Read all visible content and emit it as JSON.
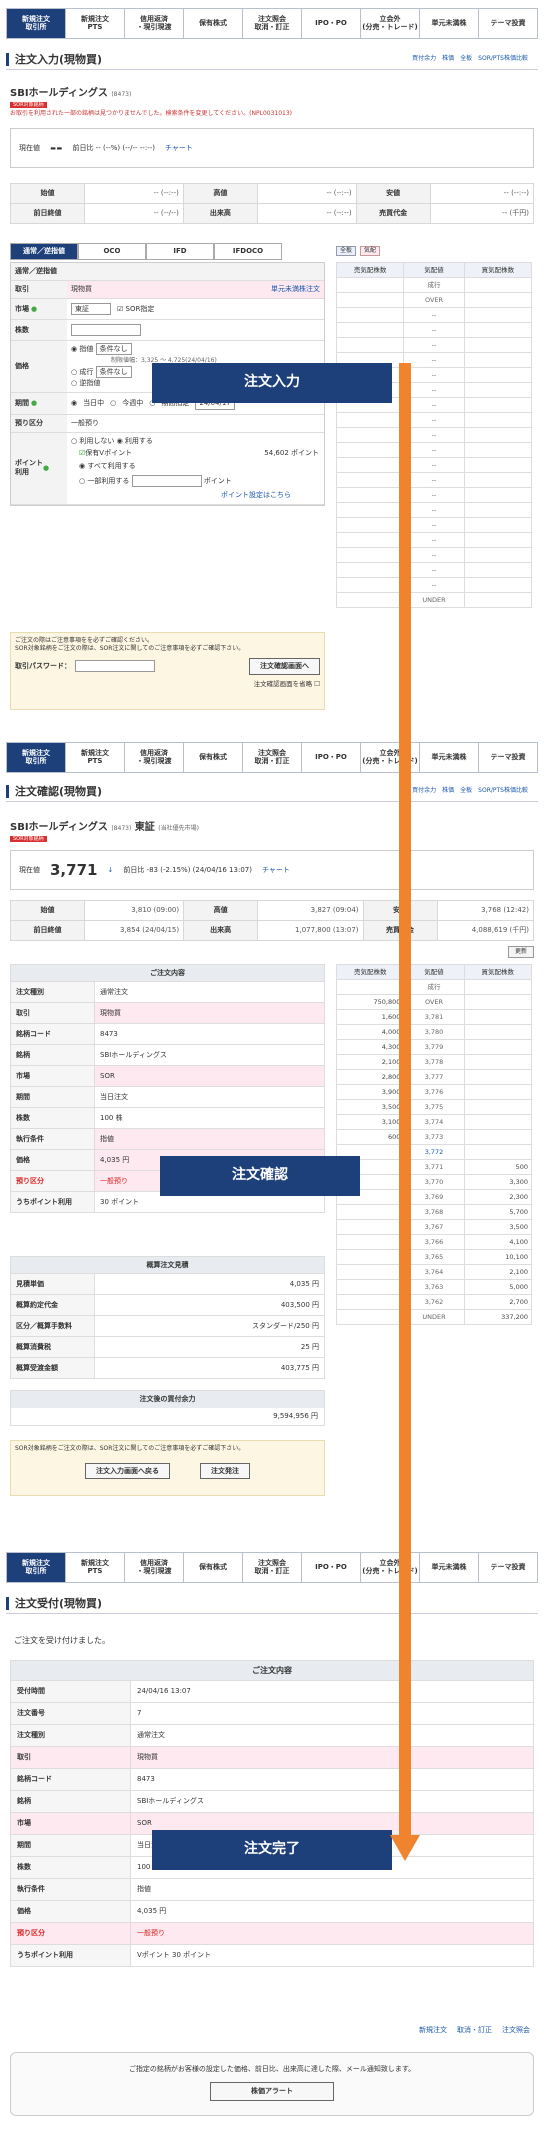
{
  "nav": [
    "新規注文\n取引所",
    "新規注文\nPTS",
    "信用返済\n・現引現渡",
    "保有株式",
    "注文照会\n取消・訂正",
    "IPO・PO",
    "立会外\n(分売・トレード)",
    "単元未満株",
    "テーマ投資"
  ],
  "s1": {
    "title": "注文入力(現物買)",
    "links": [
      "買付余力",
      "株価",
      "全板",
      "SOR/PTS株価比較"
    ],
    "stock": "SBIホールディングス",
    "code": "(8473)",
    "badge": "SOR対象銘柄",
    "note": "お取引を利用された一部の銘柄は見つかりませんでした。検索条件を変更してください。(NPL0031013)",
    "price_label": "現在値",
    "price": "--",
    "change": "前日比 -- (--%) (--/-- --:--)",
    "chart": "チャート",
    "quote": [
      [
        "始値",
        "-- (--:--)",
        "高値",
        "-- (--:--)",
        "安値",
        "-- (--:--)"
      ],
      [
        "前日終値",
        "-- (--/--)",
        "出来高",
        "-- (--:--)",
        "売買代金",
        "-- (千円)"
      ]
    ],
    "tabs": [
      "通常／逆指値",
      "OCO",
      "IFD",
      "IFDOCO"
    ],
    "form_head": "通常／逆指値",
    "trade": "現物買",
    "unit_link": "単元未満株注文",
    "market": "東証",
    "sor": "SOR指定",
    "price_opts": [
      "指値",
      "条件なし",
      "成行",
      "逆指値"
    ],
    "price_range": "制限値幅：3,325 ～ 4,725(24/04/16)",
    "period": [
      "当日中",
      "今週中",
      "期間指定",
      "24/04/17"
    ],
    "deposit": "一般預り",
    "point_opts": [
      "利用しない",
      "利用する"
    ],
    "vpoint": "保有Vポイント",
    "vpoint_val": "54,602 ポイント",
    "point_all": "すべて利用する",
    "point_part": "一部利用する",
    "point_unit": "ポイント",
    "point_link": "ポイント設定はこちら",
    "caution1": "ご注文の際はご注意事項をを必ずご確認ください。",
    "caution2": "SOR対象銘柄をご注文の際は、SOR注文に関してのご注意事項を必ずご確認下さい。",
    "pw_label": "取引パスワード：",
    "confirm_btn": "注文確認画面へ",
    "skip": "注文確認画面を省略",
    "book_btns": [
      "全板",
      "気配"
    ],
    "book_head": [
      "売気配株数",
      "気配値",
      "買気配株数"
    ],
    "book_rows": [
      [
        "",
        "成行",
        ""
      ],
      [
        "",
        "OVER",
        ""
      ],
      [
        "",
        "--",
        ""
      ],
      [
        "",
        "--",
        ""
      ],
      [
        "",
        "--",
        ""
      ],
      [
        "",
        "--",
        ""
      ],
      [
        "",
        "--",
        ""
      ],
      [
        "",
        "--",
        ""
      ],
      [
        "",
        "--",
        ""
      ],
      [
        "",
        "--",
        ""
      ],
      [
        "",
        "--",
        ""
      ],
      [
        "",
        "--",
        ""
      ],
      [
        "",
        "--",
        ""
      ],
      [
        "",
        "--",
        ""
      ],
      [
        "",
        "--",
        ""
      ],
      [
        "",
        "--",
        ""
      ],
      [
        "",
        "--",
        ""
      ],
      [
        "",
        "--",
        ""
      ],
      [
        "",
        "--",
        ""
      ],
      [
        "",
        "--",
        ""
      ],
      [
        "",
        "--",
        ""
      ],
      [
        "",
        "UNDER",
        ""
      ]
    ],
    "label": "注文入力"
  },
  "s2": {
    "title": "注文確認(現物買)",
    "stock": "SBIホールディングス",
    "code": "(8473)",
    "market": "東証",
    "sub": "(当社優先市場)",
    "badge": "SOR対象銘柄",
    "price_label": "現在値",
    "price": "3,771",
    "change": "前日比 -83 (-2.15%) (24/04/16 13:07)",
    "chart": "チャート",
    "quote": [
      [
        "始値",
        "3,810 (09:00)",
        "高値",
        "3,827 (09:04)",
        "安値",
        "3,768 (12:42)"
      ],
      [
        "前日終値",
        "3,854 (24/04/15)",
        "出来高",
        "1,077,800 (13:07)",
        "売買代金",
        "4,088,619 (千円)"
      ]
    ],
    "update": "更新",
    "conf_head": "ご注文内容",
    "conf": [
      [
        "注文種別",
        "通常注文",
        false
      ],
      [
        "取引",
        "現物買",
        true
      ],
      [
        "銘柄コード",
        "8473",
        false
      ],
      [
        "銘柄",
        "SBIホールディングス",
        false
      ],
      [
        "市場",
        "SOR",
        true
      ],
      [
        "期間",
        "当日注文",
        false
      ],
      [
        "株数",
        "100 株",
        false
      ],
      [
        "執行条件",
        "指値",
        true
      ],
      [
        "価格",
        "4,035 円",
        true
      ],
      [
        "預り区分",
        "一般預り",
        true
      ],
      [
        "うちポイント利用",
        "30 ポイント",
        false
      ]
    ],
    "est_head": "概算注文見積",
    "est": [
      [
        "見積単価",
        "4,035 円"
      ],
      [
        "概算約定代金",
        "403,500 円"
      ],
      [
        "区分／概算手数料",
        "スタンダード/250 円"
      ],
      [
        "概算消費税",
        "25 円"
      ],
      [
        "概算受渡金額",
        "403,775 円"
      ]
    ],
    "after_head": "注文後の買付余力",
    "after": "9,594,956 円",
    "caution": "SOR対象銘柄をご注文の際は、SOR注文に関してのご注意事項を必ずご確認下さい。",
    "back_btn": "注文入力画面へ戻る",
    "order_btn": "注文発注",
    "book_head": [
      "売気配株数",
      "気配値",
      "買気配株数"
    ],
    "book_rows": [
      [
        "",
        "成行",
        ""
      ],
      [
        "750,800",
        "OVER",
        ""
      ],
      [
        "1,600",
        "3,781",
        ""
      ],
      [
        "4,000",
        "3,780",
        ""
      ],
      [
        "4,300",
        "3,779",
        ""
      ],
      [
        "2,100",
        "3,778",
        ""
      ],
      [
        "2,800",
        "3,777",
        ""
      ],
      [
        "3,900",
        "3,776",
        ""
      ],
      [
        "3,500",
        "3,775",
        ""
      ],
      [
        "3,100",
        "3,774",
        ""
      ],
      [
        "600",
        "3,773",
        ""
      ],
      [
        "",
        "3,772",
        ""
      ],
      [
        "",
        "3,771",
        "500"
      ],
      [
        "",
        "3,770",
        "3,300"
      ],
      [
        "",
        "3,769",
        "2,300"
      ],
      [
        "",
        "3,768",
        "5,700"
      ],
      [
        "",
        "3,767",
        "3,500"
      ],
      [
        "",
        "3,766",
        "4,100"
      ],
      [
        "",
        "3,765",
        "10,100"
      ],
      [
        "",
        "3,764",
        "2,100"
      ],
      [
        "",
        "3,763",
        "5,000"
      ],
      [
        "",
        "3,762",
        "2,700"
      ],
      [
        "",
        "UNDER",
        "337,200"
      ]
    ],
    "label": "注文確認"
  },
  "s3": {
    "title": "注文受付(現物買)",
    "msg": "ご注文を受け付けました。",
    "head": "ご注文内容",
    "rows": [
      [
        "受付時間",
        "24/04/16 13:07",
        false
      ],
      [
        "注文番号",
        "7",
        false
      ],
      [
        "注文種別",
        "通常注文",
        false
      ],
      [
        "取引",
        "現物買",
        true
      ],
      [
        "銘柄コード",
        "8473",
        false
      ],
      [
        "銘柄",
        "SBIホールディングス",
        false
      ],
      [
        "市場",
        "SOR",
        true
      ],
      [
        "期間",
        "当日注文",
        false
      ],
      [
        "株数",
        "100 株",
        false
      ],
      [
        "執行条件",
        "指値",
        false
      ],
      [
        "価格",
        "4,035 円",
        false
      ],
      [
        "預り区分",
        "一般預り",
        true
      ],
      [
        "うちポイント利用",
        "Vポイント 30 ポイント",
        false
      ]
    ],
    "foot_links": [
      "新規注文",
      "取消・訂正",
      "注文照会"
    ],
    "alert_msg": "ご指定の銘柄がお客様の設定した価格、前日比、出来高に達した際、メール通知致します。",
    "alert_btn": "株価アラート",
    "label": "注文完了"
  },
  "colors": {
    "navy": "#1d3f7a",
    "arrow": "#f0842e",
    "pink": "#fde9ef"
  }
}
